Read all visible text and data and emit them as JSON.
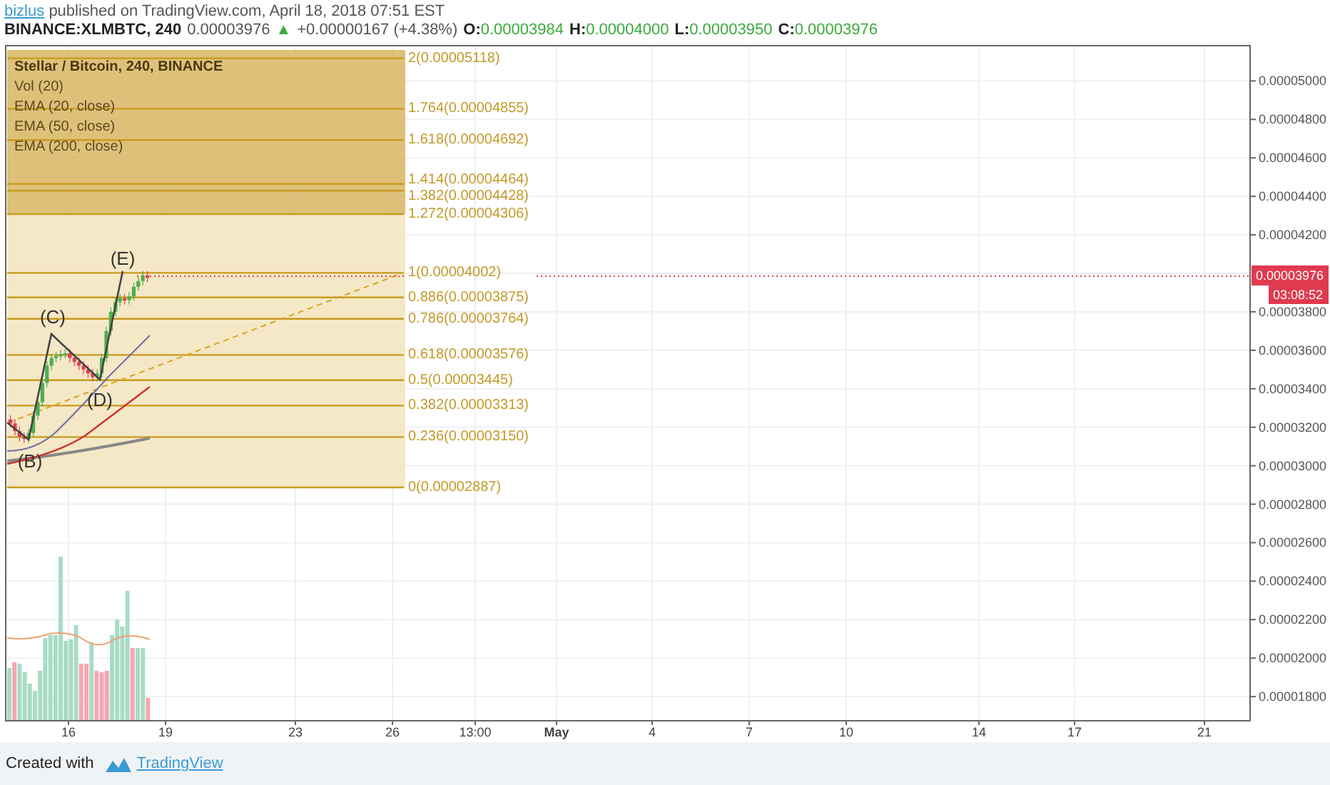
{
  "header": {
    "author": "bizlus",
    "published": "published on TradingView.com, April 18, 2018 07:51 EST"
  },
  "quote": {
    "symbol": "BINANCE:XLMBTC, 240",
    "price": "0.00003976",
    "arrow": "▲",
    "change": "+0.00000167 (+4.38%)",
    "ohlc": [
      {
        "label": "O:",
        "value": "0.00003984"
      },
      {
        "label": "H:",
        "value": "0.00004000"
      },
      {
        "label": "L:",
        "value": "0.00003950"
      },
      {
        "label": "C:",
        "value": "0.00003976"
      }
    ]
  },
  "legend": [
    {
      "text": "Stellar / Bitcoin, 240, BINANCE",
      "kind": "title"
    },
    {
      "text": "Vol (20)",
      "kind": "study"
    },
    {
      "text": "EMA (20, close)",
      "kind": "study"
    },
    {
      "text": "EMA (50, close)",
      "kind": "study"
    },
    {
      "text": "EMA (200, close)",
      "kind": "study"
    }
  ],
  "fib_levels": [
    {
      "label": "2(0.00005118)"
    },
    {
      "label": "1.764(0.00004855)"
    },
    {
      "label": "1.618(0.00004692)"
    },
    {
      "label": "1.414(0.00004464)"
    },
    {
      "label": "1.382(0.00004428)"
    },
    {
      "label": "1.272(0.00004306)"
    },
    {
      "label": "1(0.00004002)"
    },
    {
      "label": "0.886(0.00003875)"
    },
    {
      "label": "0.786(0.00003764)"
    },
    {
      "label": "0.618(0.00003576)"
    },
    {
      "label": "0.5(0.00003445)"
    },
    {
      "label": "0.382(0.00003313)"
    },
    {
      "label": "0.236(0.00003150)"
    },
    {
      "label": "0(0.00002887)"
    }
  ],
  "wave_labels": [
    "(B)",
    "(C)",
    "(D)",
    "(E)"
  ],
  "price_axis": {
    "ticks": [
      "0.00005000",
      "0.00004800",
      "0.00004600",
      "0.00004400",
      "0.00004200",
      "0.00003800",
      "0.00003600",
      "0.00003400",
      "0.00003200",
      "0.00003000",
      "0.00002800",
      "0.00002600",
      "0.00002400",
      "0.00002200",
      "0.00002000",
      "0.00001800"
    ],
    "last_price": "0.00003976",
    "countdown": "03:08:52"
  },
  "time_axis": [
    {
      "label": "16",
      "kind": "day"
    },
    {
      "label": "19",
      "kind": "day"
    },
    {
      "label": "23",
      "kind": "day"
    },
    {
      "label": "26",
      "kind": "day"
    },
    {
      "label": "13:00",
      "kind": "day"
    },
    {
      "label": "May",
      "kind": "month"
    },
    {
      "label": "4",
      "kind": "day"
    },
    {
      "label": "7",
      "kind": "day"
    },
    {
      "label": "10",
      "kind": "day"
    },
    {
      "label": "14",
      "kind": "day"
    },
    {
      "label": "17",
      "kind": "day"
    },
    {
      "label": "21",
      "kind": "day"
    }
  ],
  "footer": {
    "text": "Created with",
    "brand": "TradingView"
  }
}
